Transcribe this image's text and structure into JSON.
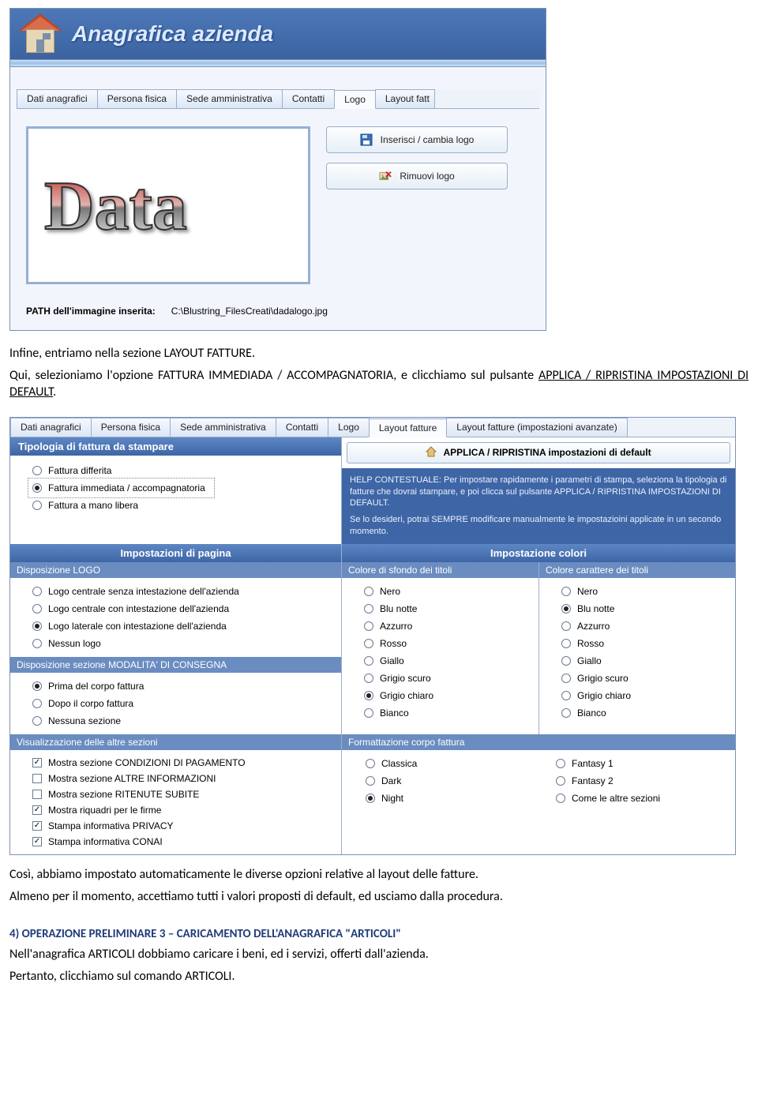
{
  "screenshot1": {
    "titlebar": "Anagrafica azienda",
    "tabs": [
      "Dati anagrafici",
      "Persona fisica",
      "Sede amministrativa",
      "Contatti",
      "Logo",
      "Layout fatt"
    ],
    "active_tab_index": 4,
    "logo_word": "Data",
    "buttons": {
      "insert": "Inserisci / cambia logo",
      "remove": "Rimuovi logo"
    },
    "path_label": "PATH dell'immagine inserita:",
    "path_value": "C:\\Blustring_FilesCreati\\dadalogo.jpg"
  },
  "doc": {
    "p1a": "Infine, entriamo nella sezione LAYOUT FATTURE.",
    "p1b_pre": "Qui, selezioniamo l'opzione FATTURA IMMEDIADA / ACCOMPAGNATORIA, e clicchiamo sul pulsante ",
    "p1b_u": "APPLICA / RIPRISTINA IMPOSTAZIONI DI DEFAULT",
    "p1b_post": ".",
    "p2a": "Così, abbiamo impostato automaticamente le diverse opzioni relative al layout delle fatture.",
    "p2b": "Almeno per il momento, accettiamo tutti i valori proposti di default, ed usciamo dalla procedura.",
    "h4": "4) OPERAZIONE PRELIMINARE 3 – CARICAMENTO DELL'ANAGRAFICA \"ARTICOLI\"",
    "p3a": "Nell'anagrafica ARTICOLI dobbiamo caricare i beni, ed i servizi, offerti dall'azienda.",
    "p3b": "Pertanto, clicchiamo sul comando ARTICOLI."
  },
  "screenshot2": {
    "tabs": [
      "Dati anagrafici",
      "Persona fisica",
      "Sede amministrativa",
      "Contatti",
      "Logo",
      "Layout fatture",
      "Layout fatture (impostazioni avanzate)"
    ],
    "active_tab_index": 5,
    "tipologia": {
      "title": "Tipologia di fattura da stampare",
      "options": [
        "Fattura differita",
        "Fattura immediata / accompagnatoria",
        "Fattura a mano libera"
      ],
      "selected_index": 1
    },
    "apply_btn": "APPLICA / RIPRISTINA impostazioni di default",
    "help_lines": [
      "HELP CONTESTUALE: Per impostare rapidamente i parametri di stampa, seleziona la tipologia di fatture che dovrai stampare, e poi clicca sul pulsante APPLICA / RIPRISTINA IMPOSTAZIONI DI DEFAULT.",
      "Se lo desideri, potrai SEMPRE modificare manualmente le impostazioini applicate in un secondo momento."
    ],
    "impostazioni_pagina_title": "Impostazioni di pagina",
    "impostazione_colori_title": "Impostazione colori",
    "disposizione_logo": {
      "title": "Disposizione LOGO",
      "options": [
        "Logo centrale senza intestazione dell'azienda",
        "Logo centrale con intestazione dell'azienda",
        "Logo laterale con intestazione dell'azienda",
        "Nessun logo"
      ],
      "selected_index": 2
    },
    "colore_sfondo": {
      "title": "Colore di sfondo dei titoli",
      "options": [
        "Nero",
        "Blu notte",
        "Azzurro",
        "Rosso",
        "Giallo",
        "Grigio scuro",
        "Grigio chiaro",
        "Bianco"
      ],
      "selected_index": 6
    },
    "colore_carattere": {
      "title": "Colore carattere dei titoli",
      "options": [
        "Nero",
        "Blu notte",
        "Azzurro",
        "Rosso",
        "Giallo",
        "Grigio scuro",
        "Grigio chiaro",
        "Bianco"
      ],
      "selected_index": 1
    },
    "modalita_consegna": {
      "title": "Disposizione sezione MODALITA' DI CONSEGNA",
      "options": [
        "Prima del corpo fattura",
        "Dopo il corpo fattura",
        "Nessuna sezione"
      ],
      "selected_index": 0
    },
    "altre_sezioni": {
      "title": "Visualizzazione delle altre sezioni",
      "items": [
        {
          "label": "Mostra sezione CONDIZIONI DI PAGAMENTO",
          "checked": true
        },
        {
          "label": "Mostra sezione ALTRE INFORMAZIONI",
          "checked": false
        },
        {
          "label": "Mostra sezione RITENUTE SUBITE",
          "checked": false
        },
        {
          "label": "Mostra riquadri per le firme",
          "checked": true
        },
        {
          "label": "Stampa informativa PRIVACY",
          "checked": true
        },
        {
          "label": "Stampa informativa CONAI",
          "checked": true
        }
      ]
    },
    "formattazione_corpo": {
      "title": "Formattazione corpo fattura",
      "left": {
        "options": [
          "Classica",
          "Dark",
          "Night"
        ],
        "selected_index": 2
      },
      "right": {
        "options": [
          "Fantasy 1",
          "Fantasy 2",
          "Come le altre sezioni"
        ],
        "selected_index": -1
      }
    }
  }
}
